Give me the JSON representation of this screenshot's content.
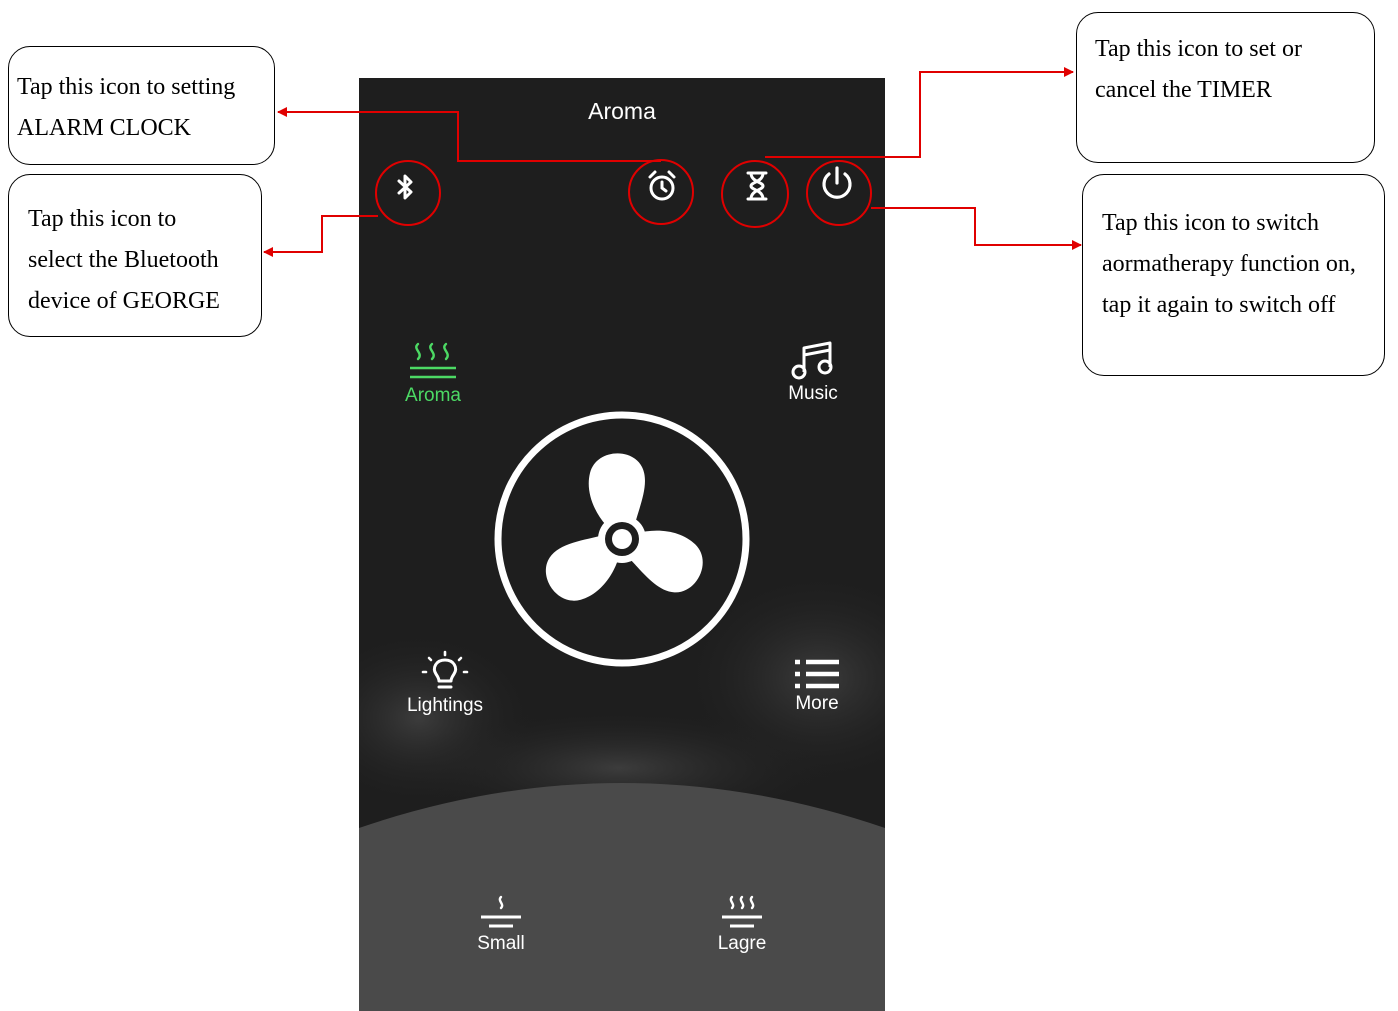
{
  "app": {
    "title": "Aroma",
    "header_icons": [
      "bluetooth-icon",
      "alarm-clock-icon",
      "hourglass-timer-icon",
      "power-icon"
    ]
  },
  "modes": {
    "aroma": {
      "label": "Aroma",
      "icon": "steam-waves-icon",
      "active": true
    },
    "music": {
      "label": "Music",
      "icon": "music-note-icon",
      "active": false
    },
    "lightings": {
      "label": "Lightings",
      "icon": "light-bulb-icon",
      "active": false
    },
    "more": {
      "label": "More",
      "icon": "list-menu-icon",
      "active": false
    }
  },
  "center": {
    "icon": "fan-icon"
  },
  "mist_levels": {
    "small": {
      "label": "Small",
      "icon": "mist-small-icon"
    },
    "large": {
      "label": "Lagre",
      "icon": "mist-large-icon"
    }
  },
  "annotations": {
    "alarm": [
      "Tap this icon to setting",
      "ALARM CLOCK"
    ],
    "bluetooth": [
      "Tap this icon to",
      "select the Bluetooth",
      "device of GEORGE"
    ],
    "timer": [
      "Tap this icon to set or",
      "cancel the TIMER"
    ],
    "power": [
      "Tap this icon to switch",
      "aormatherapy function on,",
      "tap it again to switch off"
    ]
  },
  "colors": {
    "background": "#1e1e1e",
    "active_mode": "#4cd964",
    "annotation_arrow": "#e00000",
    "bottom_panel": "#4a4a4a"
  }
}
